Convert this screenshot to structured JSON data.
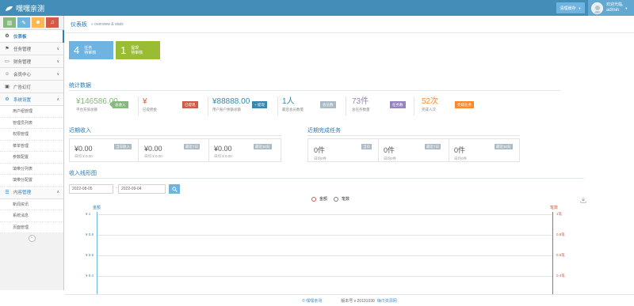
{
  "header": {
    "brand": "嘿嘿亲测",
    "mode_label": "清理缓存",
    "welcome": "欢迎光临,",
    "username": "admin"
  },
  "sidebar": {
    "shortcut_colors": [
      "#87b87f",
      "#6fb3e0",
      "#ffb752",
      "#d15b47"
    ],
    "items": [
      {
        "label": "仪表板",
        "icon": "dashboard-icon"
      },
      {
        "label": "任务管理",
        "icon": "flag-icon"
      },
      {
        "label": "财务管理",
        "icon": "inbox-icon"
      },
      {
        "label": "会员中心",
        "icon": "users-icon"
      },
      {
        "label": "广告幻灯",
        "icon": "picture-icon"
      },
      {
        "label": "系统设置",
        "icon": "cog-icon"
      }
    ],
    "system_sub": [
      "用户组管理",
      "管理员列表",
      "权限管理",
      "菜单管理",
      "参数配置",
      "填带分列表",
      "填带分配置"
    ],
    "content_label": "内容管理",
    "content_sub": [
      "新闻资讯",
      "系统消息",
      "页面管理"
    ]
  },
  "breadcrumb": {
    "title": "仪表板",
    "sub": "» overview & stats"
  },
  "tiles": [
    {
      "num": "4",
      "title": "任务",
      "sub": "待审核",
      "color": "#6fb3e0"
    },
    {
      "num": "1",
      "title": "提现",
      "sub": "待审核",
      "color": "#9abc32"
    }
  ],
  "stats": {
    "title": "统计数据",
    "items": [
      {
        "value": "¥146586.00",
        "caption": "平台充值总额",
        "badge": "总收入",
        "color": "#87b87f"
      },
      {
        "value": "¥",
        "caption": "已提佣金",
        "badge": "已提现",
        "color": "#d15b47"
      },
      {
        "value": "¥88888.00",
        "caption": "用户账户余额总额",
        "badge": "+ 提现",
        "color": "#3a87ad"
      },
      {
        "value": "1人",
        "caption": "最后会员数量",
        "badge": "会员数",
        "color": "#abbac3"
      },
      {
        "value": "73件",
        "caption": "总任务数量",
        "badge": "任务数",
        "color": "#9585bf"
      },
      {
        "value": "52次",
        "caption": "完成人次",
        "badge": "完成任务",
        "color": "#ff892a"
      }
    ]
  },
  "income": {
    "title": "近期收入",
    "items": [
      {
        "value": "¥0.00",
        "caption": "日均 ¥ 0.00",
        "tag": "当日收入"
      },
      {
        "value": "¥0.00",
        "caption": "日均 ¥ 0.00",
        "tag": "最近7日"
      },
      {
        "value": "¥0.00",
        "caption": "日均 ¥ 0.00",
        "tag": "最近30日"
      }
    ]
  },
  "tasks": {
    "title": "近期完成任务",
    "items": [
      {
        "value": "0件",
        "caption": "日均0件",
        "tag": "当日"
      },
      {
        "value": "0件",
        "caption": "日均0件",
        "tag": "最近7日"
      },
      {
        "value": "0件",
        "caption": "日均0件",
        "tag": "最近30日"
      }
    ]
  },
  "trend": {
    "title": "收入线形图",
    "date_from": "2022-08-05",
    "date_to": "2022-09-04"
  },
  "footer": {
    "brand": "© 嘿嘿亲测",
    "version": "版本号 v 20191030",
    "source": "嗨爪资源网"
  },
  "chart_data": {
    "type": "line",
    "title": "",
    "series": [
      {
        "name": "金额",
        "color": "#d15b47",
        "axis": "left",
        "values": []
      },
      {
        "name": "笔数",
        "color": "#7a7a7a",
        "axis": "right",
        "values": []
      }
    ],
    "ylabel_left": "金额",
    "ylabel_right": "笔数",
    "yticks_left": [
      "¥ 1",
      "¥ 0.8",
      "¥ 0.6",
      "¥ 0.4"
    ],
    "yticks_right": [
      "1笔",
      "0.8笔",
      "0.6笔",
      "0.4笔"
    ],
    "ylim": [
      0,
      1
    ],
    "grid": true,
    "legend": "top-center"
  }
}
